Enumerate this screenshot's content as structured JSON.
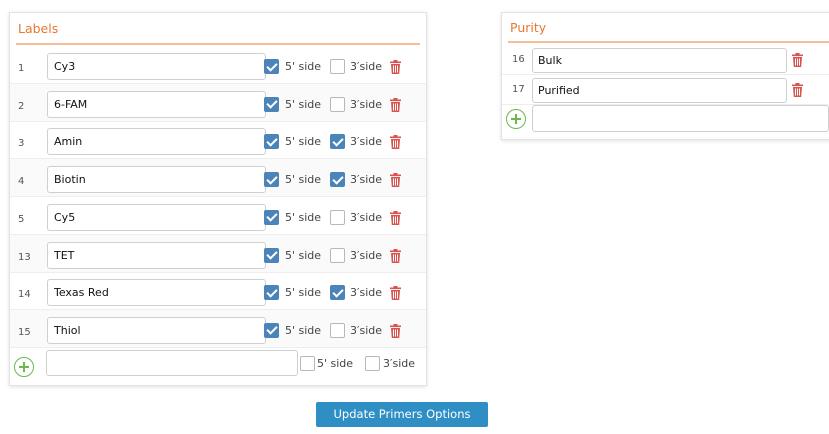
{
  "labels_panel": {
    "title": "Labels",
    "five_side_label": "5' side",
    "three_side_label": "3′side",
    "rows": [
      {
        "num": "1",
        "name": "Cy3",
        "five": true,
        "three": false
      },
      {
        "num": "2",
        "name": "6-FAM",
        "five": true,
        "three": false
      },
      {
        "num": "3",
        "name": "Amin",
        "five": true,
        "three": true
      },
      {
        "num": "4",
        "name": "Biotin",
        "five": true,
        "three": true
      },
      {
        "num": "5",
        "name": "Cy5",
        "five": true,
        "three": false
      },
      {
        "num": "13",
        "name": "TET",
        "five": true,
        "three": false
      },
      {
        "num": "14",
        "name": "Texas Red",
        "five": true,
        "three": true
      },
      {
        "num": "15",
        "name": "Thiol",
        "five": true,
        "three": false
      }
    ],
    "new_row": {
      "name": "",
      "five_label": "5' side",
      "three_label": "3′side",
      "five": false,
      "three": false
    }
  },
  "purity_panel": {
    "title": "Purity",
    "rows": [
      {
        "num": "16",
        "name": "Bulk"
      },
      {
        "num": "17",
        "name": "Purified"
      }
    ],
    "new_row": {
      "name": ""
    }
  },
  "update_button": "Update Primers Options",
  "colors": {
    "title_orange": "#e8762d",
    "checkbox_blue": "#4a84b8",
    "add_green": "#6bb84e",
    "trash_red": "#d9534f",
    "button_blue": "#2f8fc4"
  },
  "icons": {
    "trash": "trash-icon",
    "add": "add-circle-icon",
    "check": "check-icon"
  }
}
